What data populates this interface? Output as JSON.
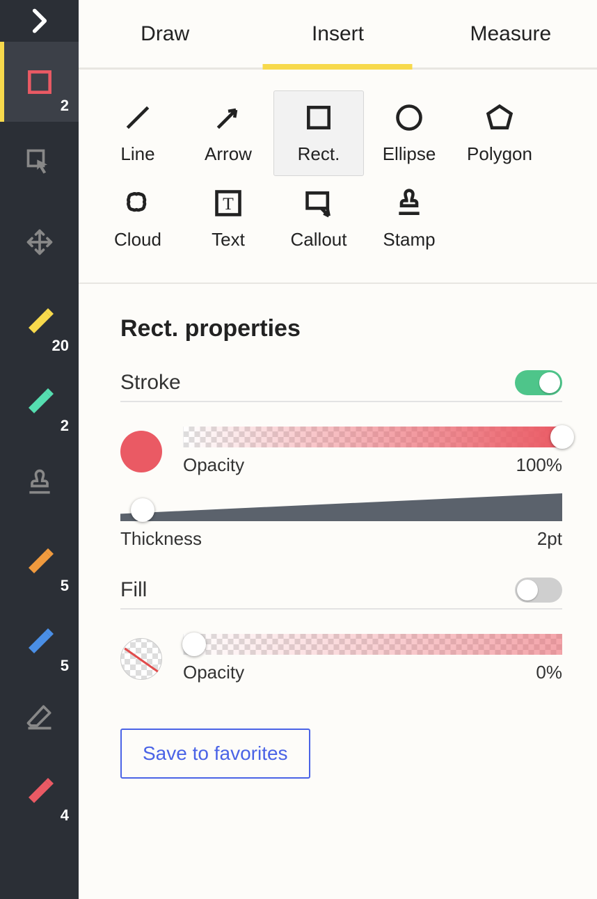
{
  "sidebar": {
    "items": [
      {
        "name": "expand-icon"
      },
      {
        "name": "rect-tool-icon",
        "badge": "2",
        "active": true
      },
      {
        "name": "lasso-select-icon"
      },
      {
        "name": "move-icon"
      },
      {
        "name": "marker-yellow-icon",
        "badge": "20",
        "color": "#f7d94c"
      },
      {
        "name": "marker-teal-icon",
        "badge": "2",
        "color": "#55ddb0"
      },
      {
        "name": "stamp-tool-icon"
      },
      {
        "name": "marker-orange-icon",
        "badge": "5",
        "color": "#f09a3e"
      },
      {
        "name": "marker-blue-icon",
        "badge": "5",
        "color": "#4a8fe6"
      },
      {
        "name": "eraser-icon"
      },
      {
        "name": "marker-red-icon",
        "badge": "4",
        "color": "#ea5a64"
      }
    ]
  },
  "tabs": [
    {
      "label": "Draw"
    },
    {
      "label": "Insert",
      "active": true
    },
    {
      "label": "Measure"
    }
  ],
  "shapes": [
    {
      "label": "Line",
      "name": "line"
    },
    {
      "label": "Arrow",
      "name": "arrow"
    },
    {
      "label": "Rect.",
      "name": "rect",
      "selected": true
    },
    {
      "label": "Ellipse",
      "name": "ellipse"
    },
    {
      "label": "Polygon",
      "name": "polygon"
    },
    {
      "label": "Cloud",
      "name": "cloud"
    },
    {
      "label": "Text",
      "name": "text"
    },
    {
      "label": "Callout",
      "name": "callout"
    },
    {
      "label": "Stamp",
      "name": "stamp"
    }
  ],
  "properties": {
    "title": "Rect. properties",
    "stroke": {
      "label": "Stroke",
      "enabled": true,
      "color": "#ea5a64",
      "opacity_label": "Opacity",
      "opacity_value": "100%",
      "opacity_percent": 100,
      "thickness_label": "Thickness",
      "thickness_value": "2pt",
      "thickness_percent": 5
    },
    "fill": {
      "label": "Fill",
      "enabled": false,
      "color": "none",
      "opacity_label": "Opacity",
      "opacity_value": "0%",
      "opacity_percent": 0
    },
    "save_label": "Save to favorites"
  }
}
